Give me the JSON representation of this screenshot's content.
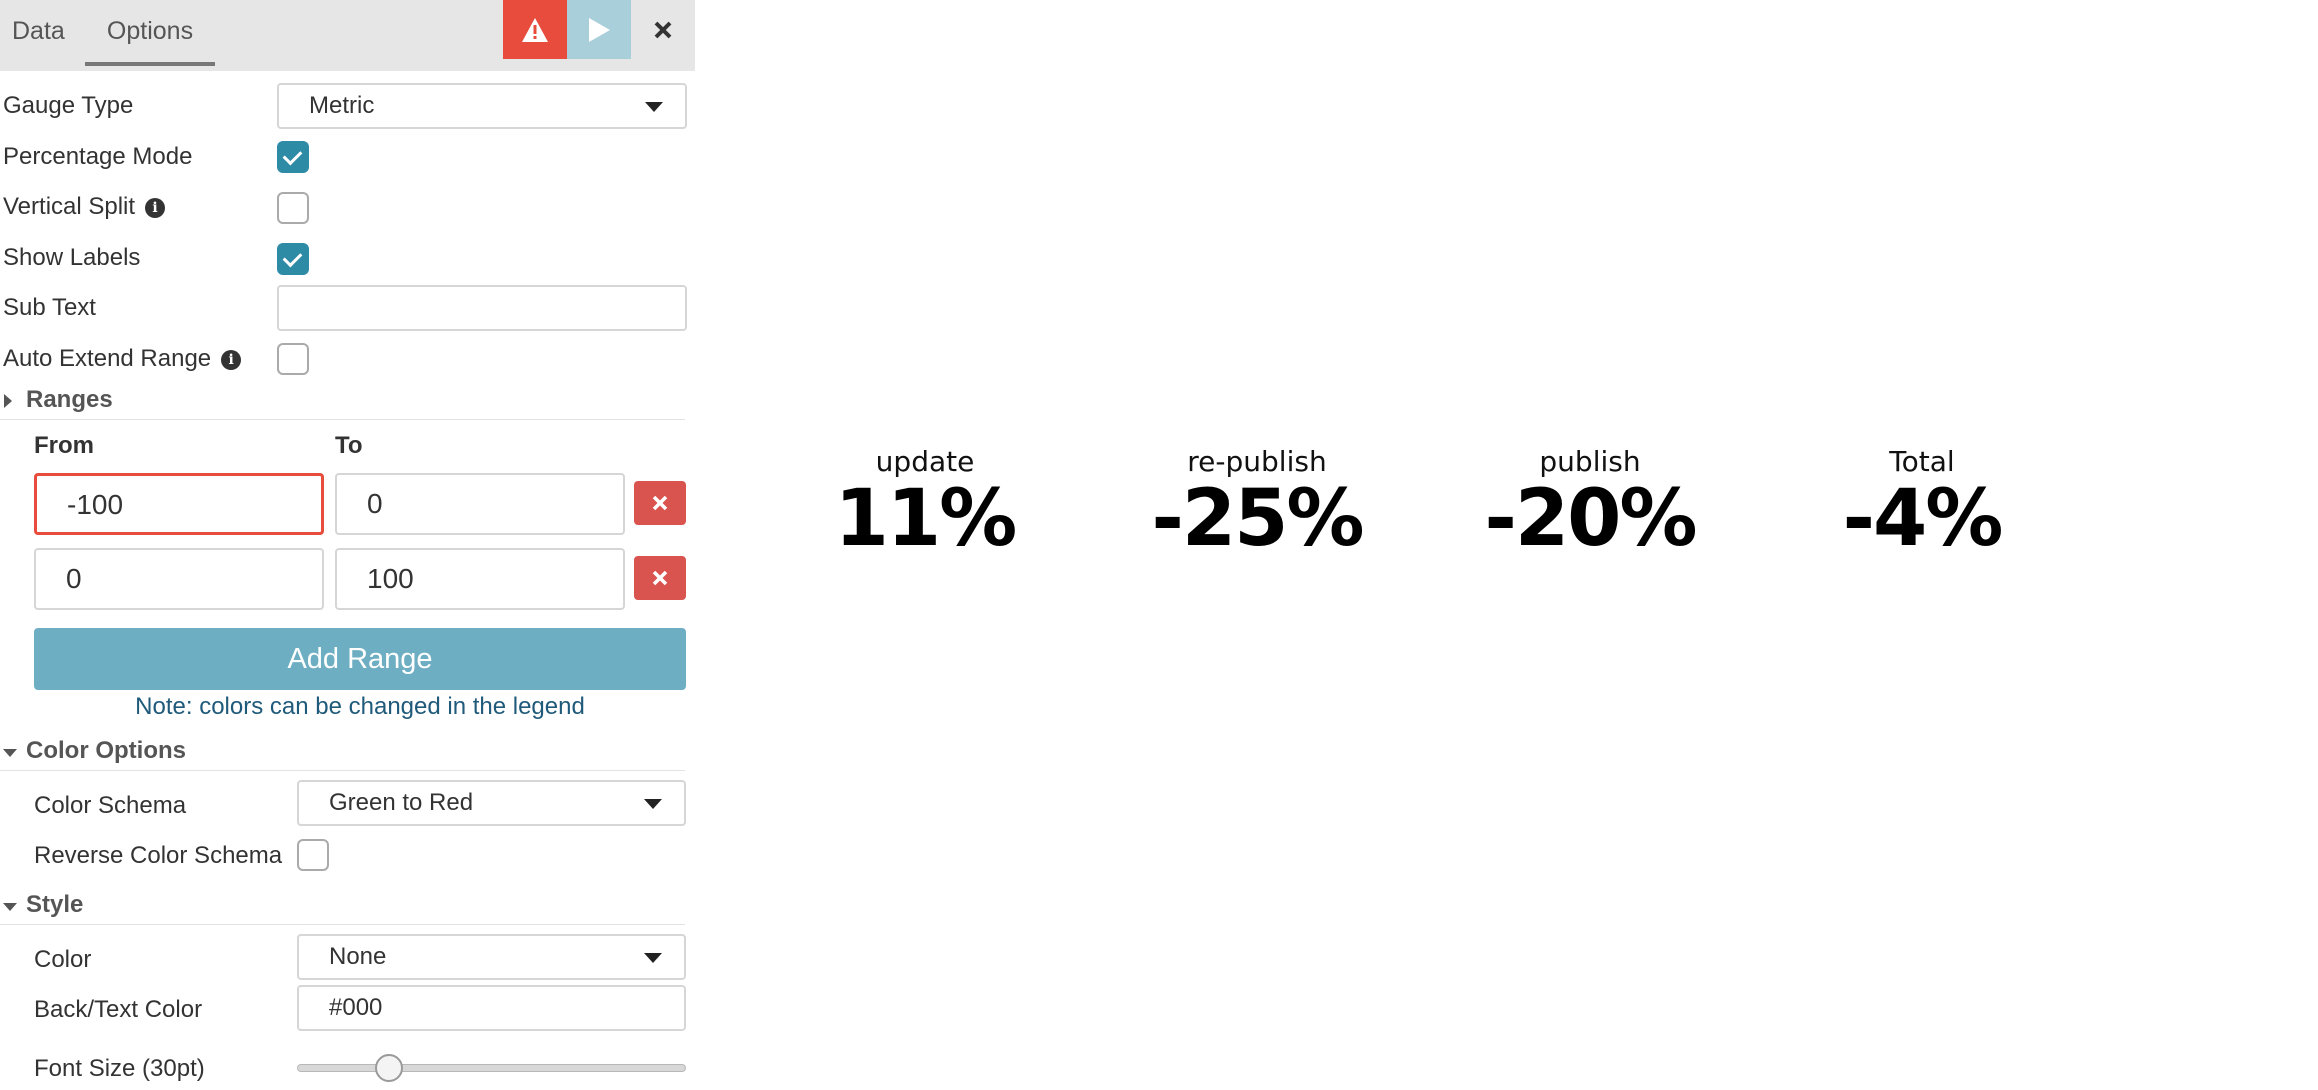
{
  "tabs": {
    "data_label": "Data",
    "options_label": "Options"
  },
  "toolbar": {
    "warning_icon": "warning-triangle-icon",
    "run_icon": "play-icon",
    "close_icon": "close-icon",
    "warning_color": "#e74c3c",
    "run_color": "#a9cfdb"
  },
  "options": {
    "gauge_type": {
      "label": "Gauge Type",
      "value": "Metric"
    },
    "percentage_mode": {
      "label": "Percentage Mode",
      "checked": true
    },
    "vertical_split": {
      "label": "Vertical Split",
      "checked": false
    },
    "show_labels": {
      "label": "Show Labels",
      "checked": true
    },
    "sub_text": {
      "label": "Sub Text",
      "value": ""
    },
    "auto_extend_range": {
      "label": "Auto Extend Range",
      "checked": false
    }
  },
  "ranges": {
    "title": "Ranges",
    "from_header": "From",
    "to_header": "To",
    "rows": [
      {
        "from": "-100",
        "to": "0"
      },
      {
        "from": "0",
        "to": "100"
      }
    ],
    "add_button": "Add Range",
    "note": "Note: colors can be changed in the legend"
  },
  "color_options": {
    "title": "Color Options",
    "schema": {
      "label": "Color Schema",
      "value": "Green to Red"
    },
    "reverse": {
      "label": "Reverse Color Schema",
      "checked": false
    }
  },
  "style": {
    "title": "Style",
    "color": {
      "label": "Color",
      "value": "None"
    },
    "back_text_color": {
      "label": "Back/Text Color",
      "value": "#000"
    },
    "font_size": {
      "label": "Font Size (30pt)",
      "value": 30,
      "min": 5,
      "max": 120
    }
  },
  "metrics": [
    {
      "label": "update",
      "value": "11%"
    },
    {
      "label": "re-publish",
      "value": "-25%"
    },
    {
      "label": "publish",
      "value": "-20%"
    },
    {
      "label": "Total",
      "value": "-4%"
    }
  ]
}
